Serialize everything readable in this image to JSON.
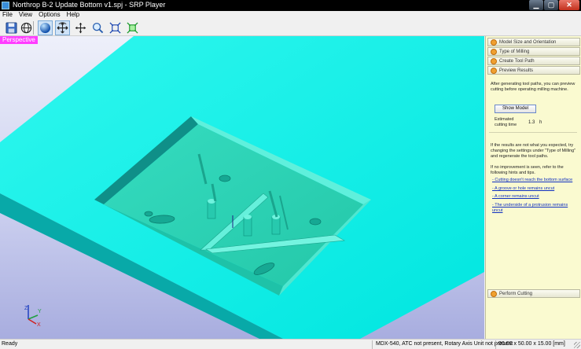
{
  "window": {
    "title": "Northrop B-2 Update Bottom v1.spj - SRP Player"
  },
  "menu": [
    "File",
    "View",
    "Options",
    "Help"
  ],
  "toolbar": {
    "buttons": [
      "save-icon",
      "globe-icon",
      "sphere-icon",
      "rotate-icon",
      "pan-icon",
      "zoom-icon",
      "fit-icon",
      "fit-all-icon"
    ]
  },
  "viewport": {
    "view_label": "Perspective",
    "axis_labels": {
      "x": "X",
      "y": "Y",
      "z": "Z"
    },
    "colors": {
      "surface": "#00ffff",
      "model": "#2ed8b8",
      "background": "#c9cdee"
    }
  },
  "panel": {
    "steps": [
      "Model Size and Orientation",
      "Type of Milling",
      "Create Tool Path",
      "Preview Results"
    ],
    "intro": "After generating tool paths, you can preview cutting before operating milling machine.",
    "show_model_button": "Show Model",
    "estimated_label": "Estimated cutting time",
    "estimated_value": "1.3",
    "estimated_unit": "h",
    "hint1": "If the results are not what you expected, try changing the settings under \"Type of Milling\" and regenerate the tool paths.",
    "hint2": "If no improvement is seen, refer to the following hints and tips.",
    "links": [
      "- Cutting doesn't reach the bottom surface",
      "- A groove or hole remains uncut",
      "- A corner remains uncut",
      "- The underside of a protrusion remains uncut"
    ],
    "perform_cutting": "Perform Cutting"
  },
  "status": {
    "left": "Ready",
    "machine": "MDX-540, ATC not present, Rotary Axis Unit not present",
    "size": "90.00 x 50.00 x 15.00 [mm]"
  }
}
